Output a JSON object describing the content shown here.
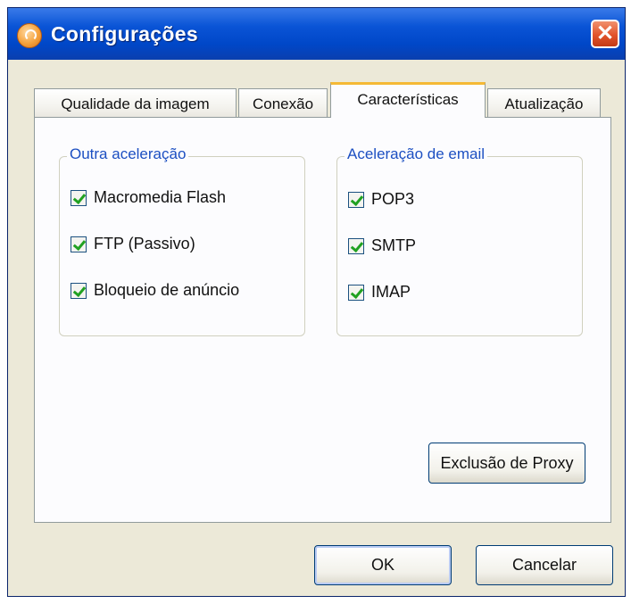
{
  "window": {
    "title": "Configurações",
    "close_glyph": "✕"
  },
  "tabs": [
    {
      "label": "Qualidade da imagem",
      "active": false
    },
    {
      "label": "Conexão",
      "active": false
    },
    {
      "label": "Características",
      "active": true
    },
    {
      "label": "Atualização",
      "active": false
    }
  ],
  "groups": {
    "outra": {
      "legend": "Outra aceleração",
      "items": [
        {
          "label": "Macromedia Flash",
          "checked": true
        },
        {
          "label": "FTP (Passivo)",
          "checked": true
        },
        {
          "label": "Bloqueio de anúncio",
          "checked": true
        }
      ]
    },
    "email": {
      "legend": "Aceleração de email",
      "items": [
        {
          "label": "POP3",
          "checked": true
        },
        {
          "label": "SMTP",
          "checked": true
        },
        {
          "label": "IMAP",
          "checked": true
        }
      ]
    }
  },
  "buttons": {
    "proxy": "Exclusão de Proxy",
    "ok": "OK",
    "cancel": "Cancelar"
  },
  "icons": {
    "app": "app-logo-icon",
    "close": "close-icon",
    "check": "checkmark-icon"
  },
  "colors": {
    "titlebar": "#0a54d6",
    "accent_tab": "#f5b935",
    "legend": "#1c4fc2",
    "check": "#21a121",
    "close": "#e2532b"
  }
}
